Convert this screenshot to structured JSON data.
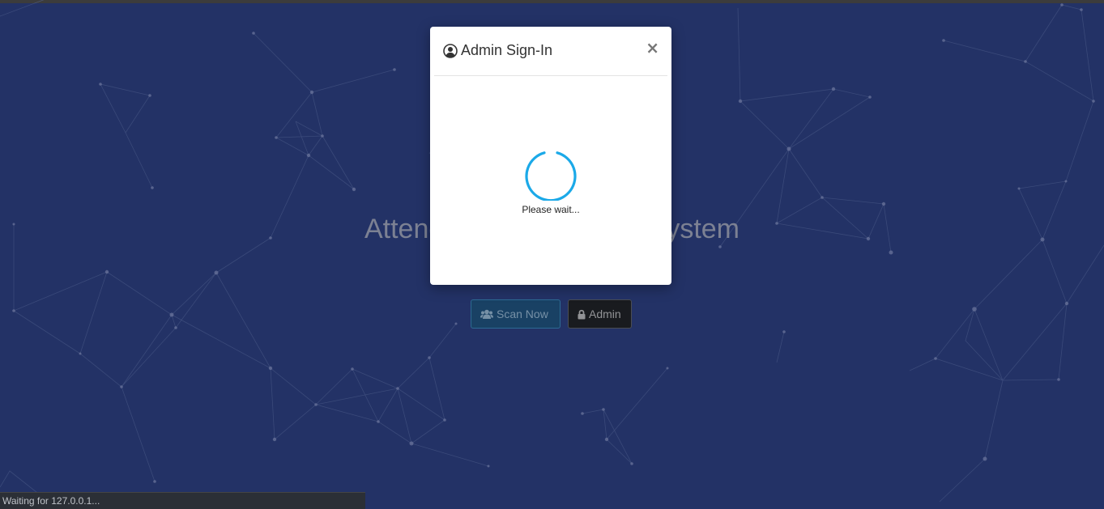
{
  "page": {
    "title": "Attendance Monitoring System"
  },
  "actions": {
    "scan_label": "Scan Now",
    "scan_icon": "users-icon",
    "admin_label": "Admin",
    "admin_icon": "lock-icon"
  },
  "modal": {
    "title": "Admin Sign-In",
    "title_icon": "user-circle-icon",
    "close_label": "×",
    "loading_text": "Please wait..."
  },
  "browser": {
    "status_text": "Waiting for 127.0.0.1..."
  },
  "colors": {
    "background": "#283a75",
    "spinner": "#1ba9e8",
    "scan_button": "#1d4b72",
    "admin_button": "#1d1f24"
  }
}
